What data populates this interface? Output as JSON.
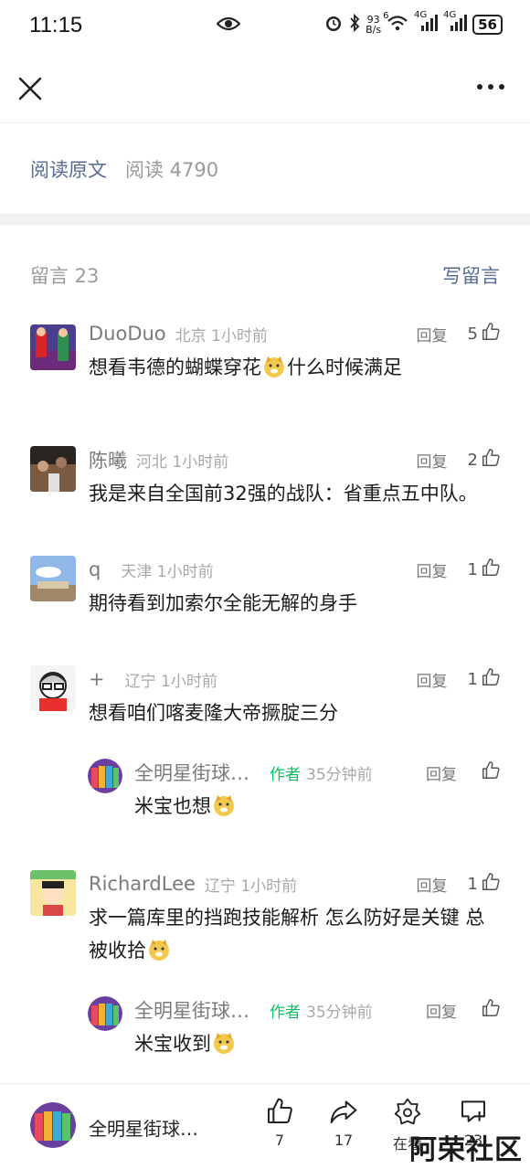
{
  "status": {
    "time": "11:15",
    "net_speed_top": "93",
    "net_speed_bottom": "B/s",
    "wifi_label": "6",
    "sig1_label": "4G",
    "sig2_label": "4G",
    "battery": "56"
  },
  "article": {
    "read_original": "阅读原文",
    "read_count": "阅读 4790"
  },
  "comments_header": {
    "count": "留言 23",
    "write": "写留言"
  },
  "comments": [
    {
      "name": "DuoDuo",
      "location": "北京 1小时前",
      "reply": "回复",
      "likes": "5",
      "text_before": "想看韦德的蝴蝶穿花",
      "text_after": "什么时候满足"
    },
    {
      "name": "陈曦",
      "location": "河北 1小时前",
      "reply": "回复",
      "likes": "2",
      "text": "我是来自全国前32强的战队：省重点五中队。"
    },
    {
      "name": "q",
      "location": "天津 1小时前",
      "reply": "回复",
      "likes": "1",
      "text": "期待看到加索尔全能无解的身手"
    },
    {
      "name": "+",
      "location": "辽宁 1小时前",
      "reply": "回复",
      "likes": "1",
      "text": "想看咱们喀麦隆大帝撅腚三分"
    },
    {
      "name": "RichardLee",
      "location": "辽宁 1小时前",
      "reply": "回复",
      "likes": "1",
      "text": "求一篇库里的挡跑技能解析 怎么防好是关键 总被收拾"
    }
  ],
  "replies": [
    {
      "name": "全明星街球…",
      "author_tag": "作者",
      "time": "35分钟前",
      "reply": "回复",
      "text": "米宝也想"
    },
    {
      "name": "全明星街球…",
      "author_tag": "作者",
      "time": "35分钟前",
      "reply": "回复",
      "text": "米宝收到"
    }
  ],
  "bottom_bar": {
    "account_name": "全明星街球…",
    "likes": "7",
    "shares": "17",
    "zaikan_label": "在看",
    "comments": "23"
  },
  "watermark": "阿荣社区",
  "icons": [
    "close-icon",
    "more-icon",
    "thumb-up-icon",
    "share-icon",
    "zaikan-icon",
    "comment-icon",
    "eye-icon",
    "alarm-icon",
    "bluetooth-icon",
    "wifi-icon",
    "signal-icon",
    "battery-icon"
  ],
  "colors": {
    "link": "#576b95",
    "author": "#07c160",
    "muted": "#9a9a9a"
  }
}
